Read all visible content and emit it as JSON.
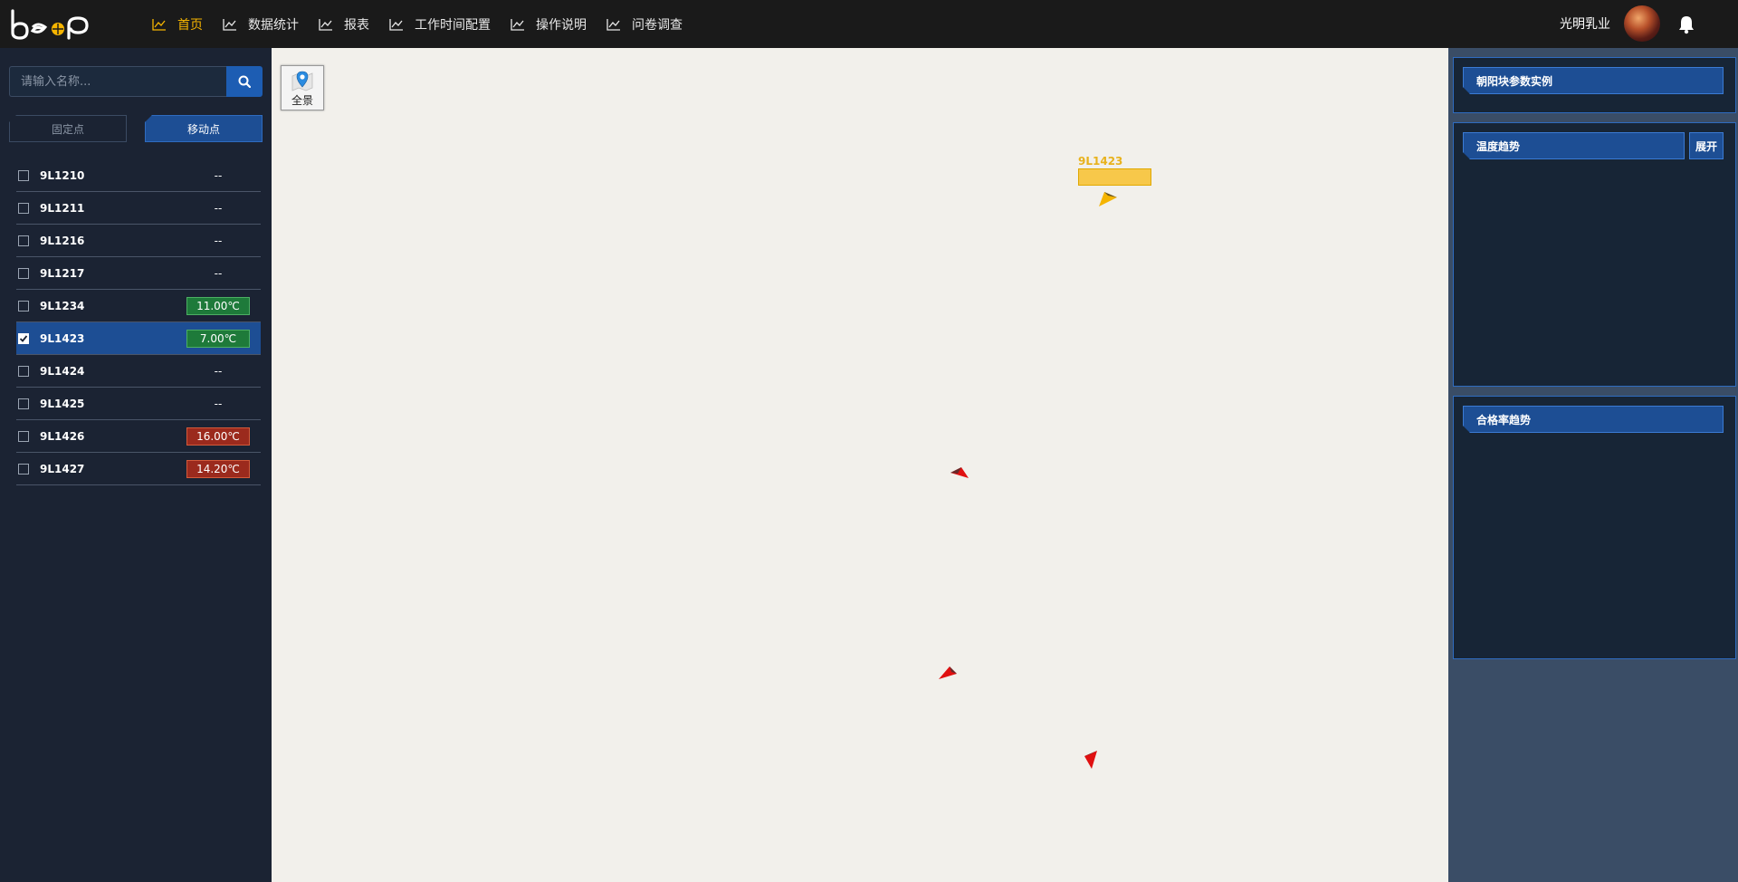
{
  "header": {
    "nav": [
      {
        "label": "首页",
        "active": true
      },
      {
        "label": "数据统计",
        "active": false
      },
      {
        "label": "报表",
        "active": false
      },
      {
        "label": "工作时间配置",
        "active": false
      },
      {
        "label": "操作说明",
        "active": false
      },
      {
        "label": "问卷调查",
        "active": false
      }
    ],
    "user_name": "光明乳业"
  },
  "sidebar": {
    "search": {
      "placeholder": "请输入名称..."
    },
    "tabs": {
      "fixed": "固定点",
      "mobile": "移动点",
      "active": "mobile"
    },
    "items": [
      {
        "name": "9L1210",
        "value": "--",
        "status": "none",
        "checked": false
      },
      {
        "name": "9L1211",
        "value": "--",
        "status": "none",
        "checked": false
      },
      {
        "name": "9L1216",
        "value": "--",
        "status": "none",
        "checked": false
      },
      {
        "name": "9L1217",
        "value": "--",
        "status": "none",
        "checked": false
      },
      {
        "name": "9L1234",
        "value": "11.00℃",
        "status": "green",
        "checked": false
      },
      {
        "name": "9L1423",
        "value": "7.00℃",
        "status": "green",
        "checked": true
      },
      {
        "name": "9L1424",
        "value": "--",
        "status": "none",
        "checked": false
      },
      {
        "name": "9L1425",
        "value": "--",
        "status": "none",
        "checked": false
      },
      {
        "name": "9L1426",
        "value": "16.00℃",
        "status": "red",
        "checked": false
      },
      {
        "name": "9L1427",
        "value": "14.20℃",
        "status": "red",
        "checked": false
      }
    ]
  },
  "map": {
    "panorama_label": "全景",
    "selected_vehicle_label": "9L1423"
  },
  "right_panel": {
    "card1_title": "朝阳块参数实例",
    "card2_title": "温度趋势",
    "card2_expand": "展开",
    "card3_title": "合格率趋势"
  },
  "colors": {
    "accent": "#1d4e94",
    "active_nav": "#f5b400",
    "ok": "#1e7a3a",
    "alarm": "#9b2a1d"
  }
}
